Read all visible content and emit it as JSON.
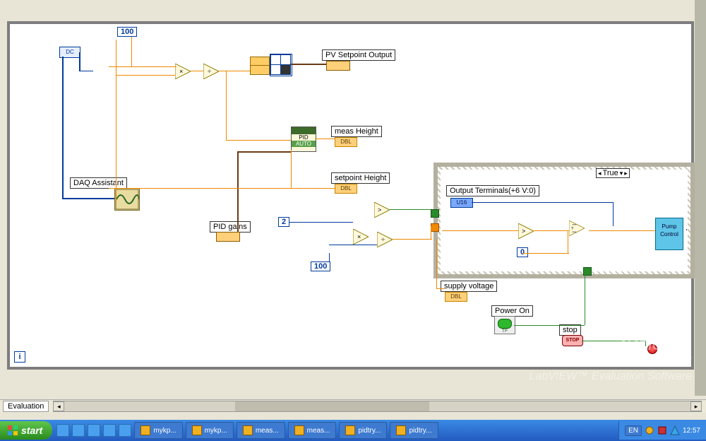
{
  "constants": {
    "c100a": "100",
    "c2": "2",
    "c100b": "100",
    "c0": "0"
  },
  "labels": {
    "pv_setpoint_output": "PV Setpoint Output",
    "daq_assistant": "DAQ Assistant",
    "pid_gains": "PID gains",
    "meas_height": "meas Height",
    "setpoint_height": "setpoint Height",
    "output_terminals": "Output Terminals(+6 V:0)",
    "supply_voltage": "supply voltage",
    "power_on": "Power On",
    "stop": "stop",
    "pump_control": "Pump Control"
  },
  "case": {
    "value": "True"
  },
  "pid": {
    "top": "PID",
    "bottom": "AUTO"
  },
  "terminals": {
    "dbl": "DBL",
    "u16": "U16",
    "tf": "TF",
    "stop": "STOP"
  },
  "scroll_tab": "Evaluation",
  "watermark": {
    "line1": "NATIONAL",
    "line2": "INSTRUMENTS",
    "line3": "LabVIEW™ Evaluation Software"
  },
  "taskbar": {
    "start": "start",
    "buttons": [
      "mykp...",
      "mykp...",
      "meas...",
      "meas...",
      "pidtry...",
      "pidtry..."
    ],
    "lang": "EN",
    "clock": "12:57"
  },
  "loop_index": "i",
  "dc_label": "DC"
}
